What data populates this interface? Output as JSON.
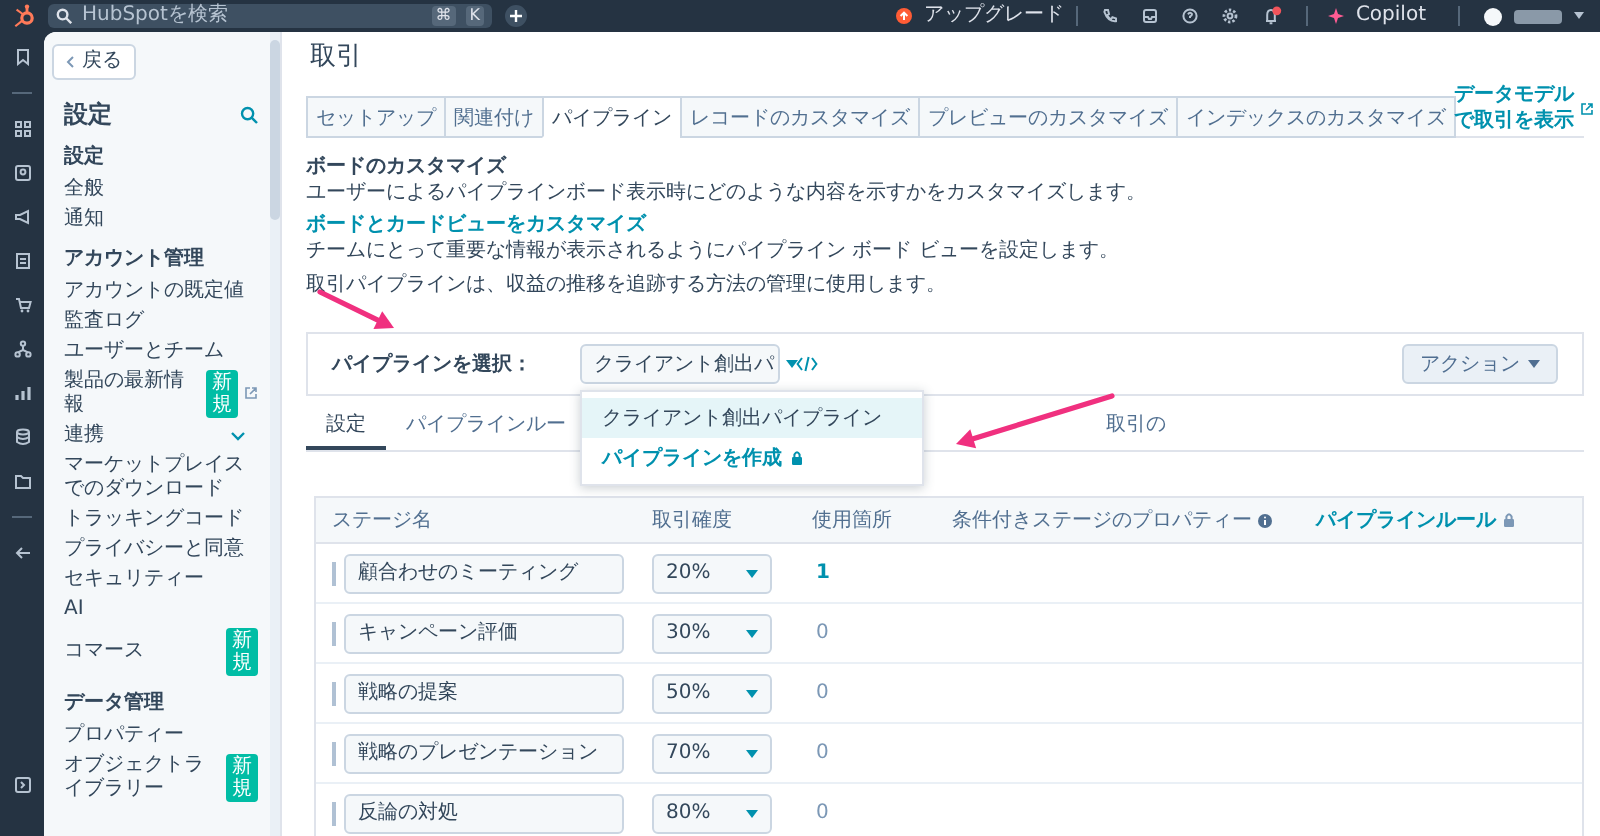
{
  "top_bar": {
    "search": {
      "placeholder": "HubSpotを検索",
      "shortcut": [
        "⌘",
        "K"
      ]
    },
    "upgrade": "アップグレード",
    "copilot": "Copilot"
  },
  "sidebar": {
    "back": "戻る",
    "title": "設定",
    "sections": [
      {
        "heading": "設定",
        "items": [
          {
            "label": "全般",
            "kind": "plain"
          },
          {
            "label": "通知",
            "kind": "plain"
          }
        ]
      },
      {
        "heading": "アカウント管理",
        "items": [
          {
            "label": "アカウントの既定値",
            "kind": "plain"
          },
          {
            "label": "監査ログ",
            "kind": "plain"
          },
          {
            "label": "ユーザーとチーム",
            "kind": "plain"
          },
          {
            "label": "製品の最新情報",
            "kind": "external",
            "badge": "新規"
          },
          {
            "label": "連携",
            "kind": "group",
            "expanded": true
          },
          {
            "label": "マーケットプレイスでのダウンロード",
            "kind": "plain"
          },
          {
            "label": "トラッキングコード",
            "kind": "plain"
          },
          {
            "label": "プライバシーと同意",
            "kind": "plain"
          },
          {
            "label": "セキュリティー",
            "kind": "plain"
          },
          {
            "label": "AI",
            "kind": "plain"
          },
          {
            "label": "コマース",
            "kind": "plain",
            "badge": "新規"
          }
        ]
      },
      {
        "heading": "データ管理",
        "items": [
          {
            "label": "プロパティー",
            "kind": "plain"
          },
          {
            "label": "オブジェクトライブラリー",
            "kind": "plain",
            "badge": "新規"
          }
        ]
      }
    ]
  },
  "main": {
    "title": "取引",
    "tabs": [
      {
        "label": "セットアップ",
        "selected": false
      },
      {
        "label": "関連付け",
        "selected": false
      },
      {
        "label": "パイプライン",
        "selected": true
      },
      {
        "label": "レコードのカスタマイズ",
        "selected": false
      },
      {
        "label": "プレビューのカスタマイズ",
        "selected": false
      },
      {
        "label": "インデックスのカスタマイズ",
        "selected": false
      }
    ],
    "data_model_link": "データモデルで取引を表示",
    "board": {
      "heading": "ボードのカスタマイズ",
      "description": "ユーザーによるパイプラインボード表示時にどのような内容を示すかをカスタマイズします。",
      "link": "ボードとカードビューをカスタマイズ",
      "link_description": "チームにとって重要な情報が表示されるようにパイプライン ボード ビューを設定します。"
    },
    "pipeline_description": "取引パイプラインは、収益の推移を追跡する方法の管理に使用します。",
    "pipeline_select": {
      "label": "パイプラインを選択：",
      "value": "クライアント創出パ",
      "action": "アクション"
    },
    "dropdown": [
      {
        "label": "クライアント創出パイプライン",
        "kind": "option",
        "selected": true
      },
      {
        "label": "パイプラインを作成",
        "kind": "create",
        "selected": false
      }
    ],
    "subtabs": [
      {
        "label": "設定",
        "selected": true
      },
      {
        "label": "パイプラインルー",
        "selected": false
      },
      {
        "label": "取引の",
        "selected": false
      }
    ],
    "table": {
      "columns": [
        {
          "label": "ステージ名",
          "kind": "plain"
        },
        {
          "label": "取引確度",
          "kind": "plain"
        },
        {
          "label": "使用箇所",
          "kind": "plain"
        },
        {
          "label": "条件付きステージのプロパティー",
          "kind": "info"
        },
        {
          "label": "パイプラインルール",
          "kind": "locked_link"
        }
      ],
      "rows": [
        {
          "stage": "顧合わせのミーティング",
          "probability": "20%",
          "usage": "1",
          "usage_link": true
        },
        {
          "stage": "キャンペーン評価",
          "probability": "30%",
          "usage": "0",
          "usage_link": false
        },
        {
          "stage": "戦略の提案",
          "probability": "50%",
          "usage": "0",
          "usage_link": false
        },
        {
          "stage": "戦略のプレゼンテーション",
          "probability": "70%",
          "usage": "0",
          "usage_link": false
        },
        {
          "stage": "反論の対処",
          "probability": "80%",
          "usage": "0",
          "usage_link": false
        }
      ]
    }
  }
}
